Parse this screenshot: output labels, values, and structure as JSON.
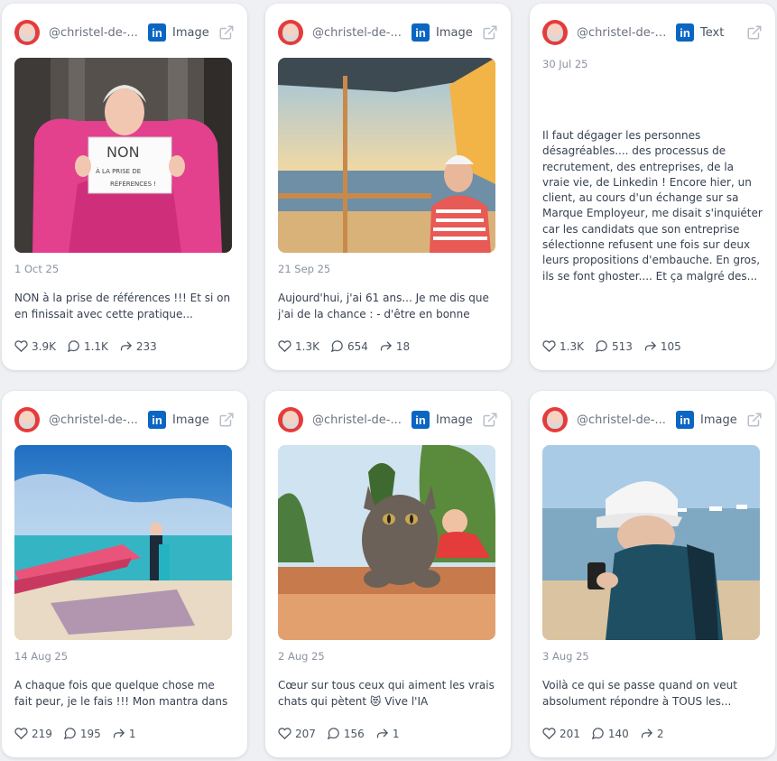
{
  "cards": [
    {
      "handle": "@christel-de-...",
      "type": "Image",
      "date": "1 Oct 25",
      "text": "NON à la prise de références !!! Et si on en finissait avec cette pratique...",
      "likes": "3.9K",
      "comments": "1.1K",
      "shares": "233",
      "image_sign": {
        "line1": "NON",
        "line2": "À LA PRISE DE",
        "line3": "RÉFÉRENCES !"
      }
    },
    {
      "handle": "@christel-de-...",
      "type": "Image",
      "date": "21 Sep 25",
      "text": "Aujourd'hui, j'ai 61 ans... Je me dis que j'ai de la chance : - d'être en bonne santé -...",
      "likes": "1.3K",
      "comments": "654",
      "shares": "18"
    },
    {
      "handle": "@christel-de-fo...",
      "type": "Text",
      "date": "30 Jul 25",
      "text": "Il faut dégager les personnes désagréables.... des processus de recrutement, des entreprises, de la vraie vie, de Linkedin ! Encore hier, un client, au cours d'un échange sur sa Marque Employeur, me disait s'inquiéter car les candidats que son entreprise sélectionne refusent une fois sur deux leurs propositions d'embauche. En gros, ils se font ghoster.... Et ça malgré des...",
      "likes": "1.3K",
      "comments": "513",
      "shares": "105"
    },
    {
      "handle": "@christel-de-...",
      "type": "Image",
      "date": "14 Aug 25",
      "text": "A chaque fois que quelque chose me fait peur, je le fais !!! Mon mantra dans la vi...",
      "likes": "219",
      "comments": "195",
      "shares": "1"
    },
    {
      "handle": "@christel-de-...",
      "type": "Image",
      "date": "2 Aug 25",
      "text": "Cœur sur tous ceux qui aiment les vrais chats qui pètent 😻 Vive l'IA (Intelligenc...",
      "likes": "207",
      "comments": "156",
      "shares": "1"
    },
    {
      "handle": "@christel-de-...",
      "type": "Image",
      "date": "3 Aug 25",
      "text": "Voilà ce qui se passe quand on veut absolument répondre à TOUS les...",
      "likes": "201",
      "comments": "140",
      "shares": "2"
    }
  ],
  "colors": {
    "linkedin": "#0a66c2",
    "avatar_bg": "#e63b3b",
    "page_bg": "#eef0f4"
  },
  "icons": {
    "like": "heart-icon",
    "comment": "comment-icon",
    "share": "share-icon",
    "external": "external-link-icon",
    "network": "linkedin-icon"
  },
  "linkedin_label": "in"
}
